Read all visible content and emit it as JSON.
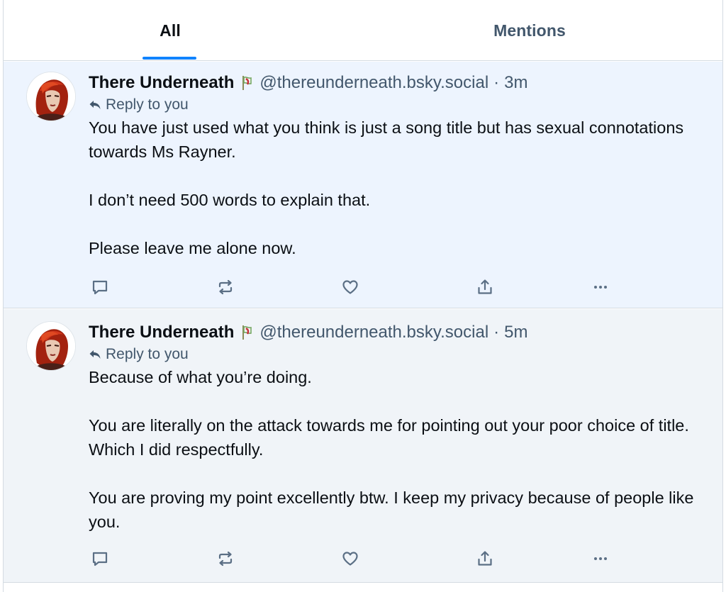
{
  "tabs": {
    "all_label": "All",
    "mentions_label": "Mentions",
    "active": "All"
  },
  "accent_color": "#1083fe",
  "posts": [
    {
      "author_name": "There Underneath",
      "badge_icon": "flag-badge-icon",
      "handle": "@thereunderneath.bsky.social",
      "separator": "·",
      "time": "3m",
      "reply_context": "Reply to you",
      "paragraphs": [
        "You have just used what you think is just a song title but has sexual connotations towards Ms Rayner.",
        "I don’t need 500 words to explain that.",
        "Please leave me alone now."
      ],
      "background": "#edf4fe"
    },
    {
      "author_name": "There Underneath",
      "badge_icon": "flag-badge-icon",
      "handle": "@thereunderneath.bsky.social",
      "separator": "·",
      "time": "5m",
      "reply_context": "Reply to you",
      "paragraphs": [
        "Because of what you’re doing.",
        "You are literally on the attack towards me for pointing out your poor choice of title. Which I did respectfully.",
        "You are proving my point excellently btw. I keep my privacy because of people like you."
      ],
      "background": "#f0f4f8"
    }
  ],
  "action_icons": [
    "comment-icon",
    "repost-icon",
    "heart-icon",
    "share-icon",
    "more-icon"
  ]
}
